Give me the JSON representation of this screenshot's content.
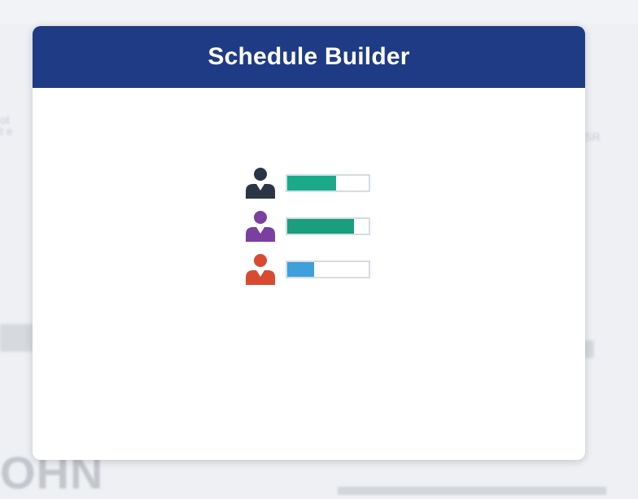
{
  "background": {
    "left_fragment": "ot\nt e",
    "right_fragment": "SR",
    "bottom_fragment": "OHN"
  },
  "dialog": {
    "title": "Schedule Builder",
    "header_color": "#1f3b86"
  },
  "illustration": {
    "rows": [
      {
        "icon": "person-icon",
        "icon_color": "#2b3545",
        "fill_color": "#1aaa8a",
        "fill_fraction": 0.6
      },
      {
        "icon": "person-icon",
        "icon_color": "#7b3fa0",
        "fill_color": "#1a9e7e",
        "fill_fraction": 0.82
      },
      {
        "icon": "person-icon",
        "icon_color": "#d94a32",
        "fill_color": "#3d9fdb",
        "fill_fraction": 0.33
      }
    ]
  }
}
